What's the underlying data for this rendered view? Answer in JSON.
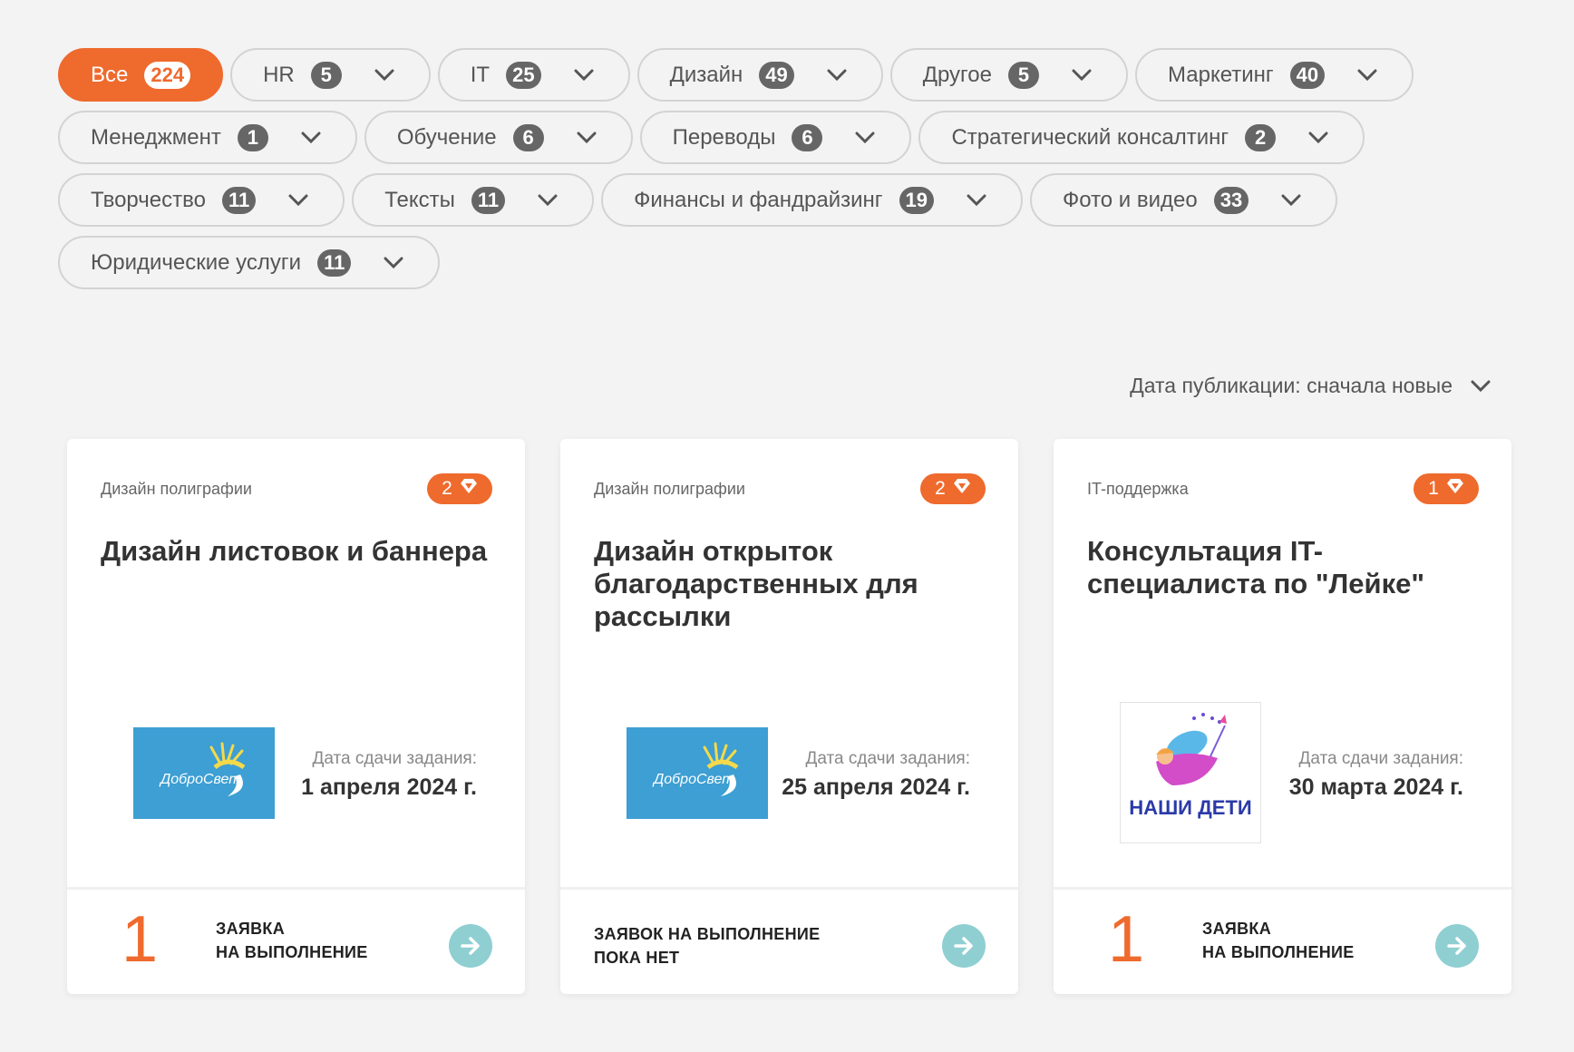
{
  "filters": [
    {
      "label": "Все",
      "count": "224",
      "active": true
    },
    {
      "label": "HR",
      "count": "5"
    },
    {
      "label": "IT",
      "count": "25"
    },
    {
      "label": "Дизайн",
      "count": "49"
    },
    {
      "label": "Другое",
      "count": "5"
    },
    {
      "label": "Маркетинг",
      "count": "40"
    },
    {
      "label": "Менеджмент",
      "count": "1"
    },
    {
      "label": "Обучение",
      "count": "6"
    },
    {
      "label": "Переводы",
      "count": "6"
    },
    {
      "label": "Стратегический консалтинг",
      "count": "2"
    },
    {
      "label": "Творчество",
      "count": "11"
    },
    {
      "label": "Тексты",
      "count": "11"
    },
    {
      "label": "Финансы и фандрайзинг",
      "count": "19"
    },
    {
      "label": "Фото и видео",
      "count": "33"
    },
    {
      "label": "Юридические услуги",
      "count": "11"
    }
  ],
  "sort": {
    "label": "Дата публикации: сначала новые"
  },
  "colors": {
    "accent": "#ef6a2d",
    "teal": "#8fcfd2",
    "logo_blue": "#3d9fd3"
  },
  "cards": [
    {
      "category": "Дизайн полиграфии",
      "badge": "2",
      "title": "Дизайн листовок и баннера",
      "logo": {
        "type": "dobrosvet",
        "text": "ДоброСвет"
      },
      "deadline_label": "Дата сдачи задания:",
      "deadline_date": "1 апреля 2024 г.",
      "applications_count": "1",
      "applications_line1": "ЗАЯВКА",
      "applications_line2": "НА ВЫПОЛНЕНИЕ"
    },
    {
      "category": "Дизайн полиграфии",
      "badge": "2",
      "title": "Дизайн открыток благодарственных для рассылки",
      "logo": {
        "type": "dobrosvet",
        "text": "ДоброСвет"
      },
      "deadline_label": "Дата сдачи задания:",
      "deadline_date": "25 апреля 2024 г.",
      "applications_count": "",
      "applications_line1": "ЗАЯВОК НА ВЫПОЛНЕНИЕ",
      "applications_line2": "ПОКА НЕТ"
    },
    {
      "category": "IT-поддержка",
      "badge": "1",
      "title": "Консультация IT-специалиста по \"Лейке\"",
      "logo": {
        "type": "nashi-deti",
        "text": "НАШИ ДЕТИ"
      },
      "deadline_label": "Дата сдачи задания:",
      "deadline_date": "30 марта 2024 г.",
      "applications_count": "1",
      "applications_line1": "ЗАЯВКА",
      "applications_line2": "НА ВЫПОЛНЕНИЕ"
    }
  ]
}
